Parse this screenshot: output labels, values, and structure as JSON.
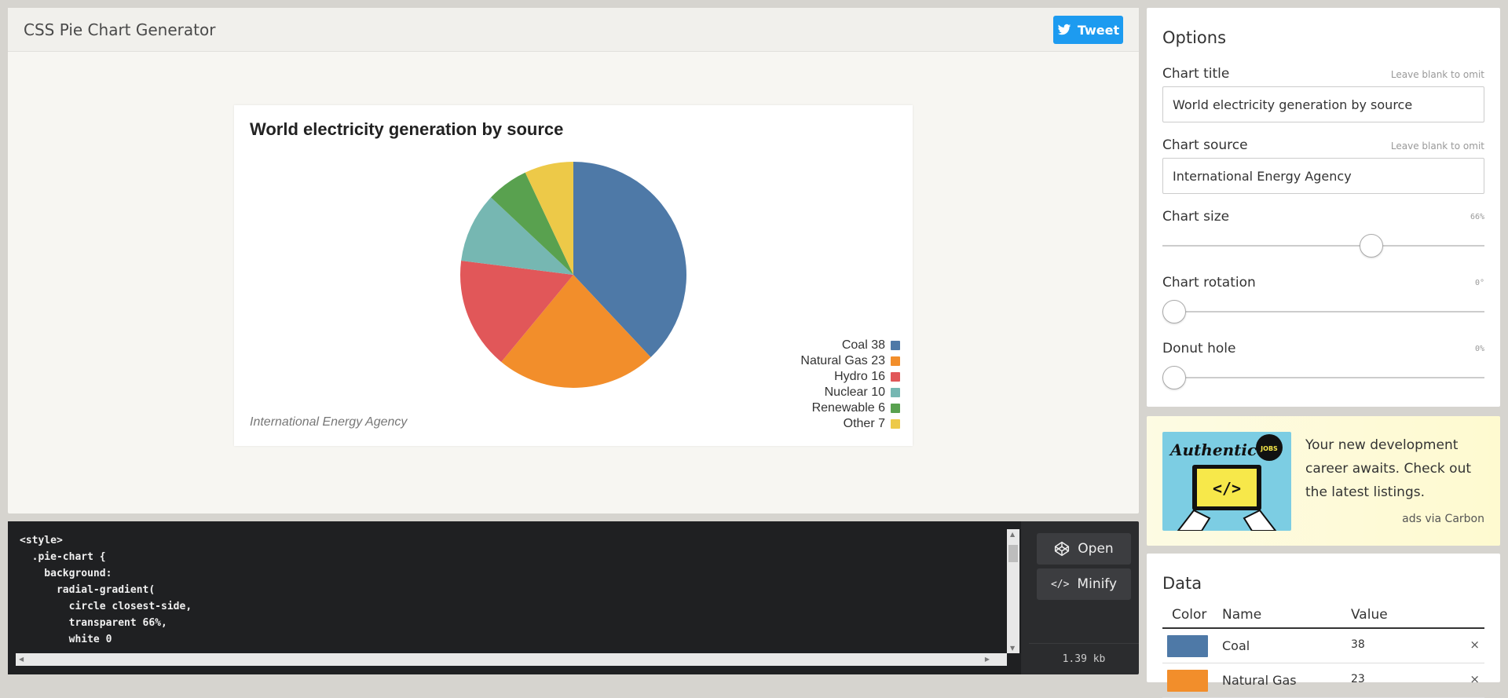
{
  "app": {
    "title": "CSS Pie Chart Generator",
    "tweet_label": "Tweet"
  },
  "chart_data": {
    "type": "pie",
    "title": "World electricity generation by source",
    "source": "International Energy Agency",
    "rotation_deg": 0,
    "donut_hole_pct": 0,
    "categories": [
      "Coal",
      "Natural Gas",
      "Hydro",
      "Nuclear",
      "Renewable",
      "Other"
    ],
    "values": [
      38,
      23,
      16,
      10,
      6,
      7
    ],
    "colors": [
      "#4e79a7",
      "#f28e2b",
      "#e15759",
      "#76b7b2",
      "#59a14f",
      "#edc948"
    ],
    "legend": [
      "Coal 38",
      "Natural Gas 23",
      "Hydro 16",
      "Nuclear 10",
      "Renewable 6",
      "Other 7"
    ],
    "legend_position": "bottom-right"
  },
  "code": {
    "lines": [
      "<style>",
      "  .pie-chart {",
      "    background:",
      "      radial-gradient(",
      "        circle closest-side,",
      "        transparent 66%,",
      "        white 0"
    ],
    "open_label": "Open",
    "minify_label": "Minify",
    "size": "1.39 kb"
  },
  "options": {
    "heading": "Options",
    "chart_title": {
      "label": "Chart title",
      "hint": "Leave blank to omit",
      "value": "World electricity generation by source"
    },
    "chart_source": {
      "label": "Chart source",
      "hint": "Leave blank to omit",
      "value": "International Energy Agency"
    },
    "chart_size": {
      "label": "Chart size",
      "value_text": "66%",
      "level": 0.66
    },
    "chart_rotation": {
      "label": "Chart rotation",
      "value_text": "0°",
      "level": 0
    },
    "donut_hole": {
      "label": "Donut hole",
      "value_text": "0%",
      "level": 0
    }
  },
  "ad": {
    "text": "Your new development career awaits. Check out the latest listings.",
    "via": "ads via Carbon",
    "brand": "Authentic",
    "badge": "JOBS"
  },
  "data_panel": {
    "heading": "Data",
    "columns": [
      "Color",
      "Name",
      "Value"
    ],
    "rows": [
      {
        "color": "#4e79a7",
        "name": "Coal",
        "value": "38",
        "remove": "×"
      },
      {
        "color": "#f28e2b",
        "name": "Natural Gas",
        "value": "23",
        "remove": "×"
      }
    ]
  }
}
